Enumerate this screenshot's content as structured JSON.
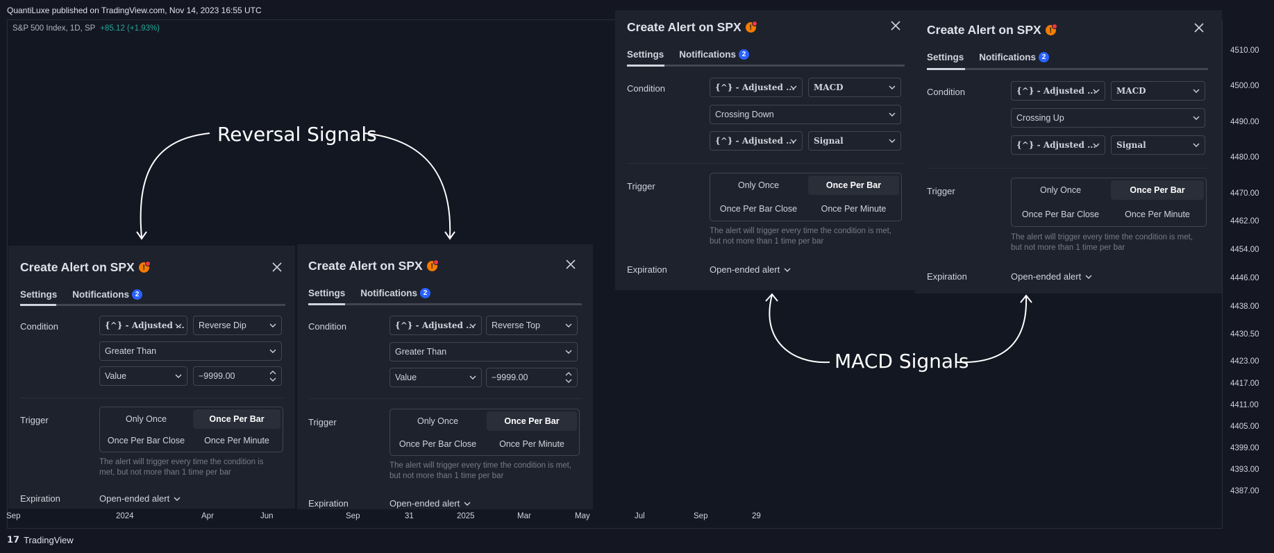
{
  "topbar": {
    "published": "QuantiLuxe published on TradingView.com, Nov 14, 2023 16:55 UTC"
  },
  "symbol": {
    "name": "S&P 500 Index, 1D, SP",
    "change": "+85.12 (+1.93%)"
  },
  "price_axis": [
    "4510.00",
    "4500.00",
    "4490.00",
    "4480.00",
    "4470.00",
    "4462.00",
    "4454.00",
    "4446.00",
    "4438.00",
    "4430.50",
    "4423.00",
    "4417.00",
    "4411.00",
    "4405.00",
    "4399.00",
    "4393.00",
    "4387.00"
  ],
  "time_axis": [
    "Sep",
    "2024",
    "Apr",
    "Jun",
    "Sep",
    "31",
    "2025",
    "Mar",
    "May",
    "Jul",
    "Sep",
    "29"
  ],
  "footer": {
    "brand": "TradingView"
  },
  "annotations": {
    "reversal": "Reversal Signals",
    "macd": "MACD Signals"
  },
  "colors": {
    "background": "#131722",
    "dialog": "#1e222d",
    "accent_badge": "#2962ff",
    "warning": "#f57c00",
    "positive": "#26a69a"
  },
  "dialogs": [
    {
      "title": "Create Alert on SPX",
      "tabs": {
        "settings": "Settings",
        "notifications": "Notifications",
        "badge": "2"
      },
      "condition_label": "Condition",
      "source": "{^} - Adjusted ...",
      "indicator": "Reverse Dip",
      "operator": "Greater Than",
      "value_type": "Value",
      "value": "−9999.00",
      "trigger_label": "Trigger",
      "trigger_options": [
        "Only Once",
        "Once Per Bar",
        "Once Per Bar Close",
        "Once Per Minute"
      ],
      "trigger_selected": "Once Per Bar",
      "hint": "The alert will trigger every time the condition is met, but not more than 1 time per bar",
      "expiration_label": "Expiration",
      "expiration_value": "Open-ended alert"
    },
    {
      "title": "Create Alert on SPX",
      "tabs": {
        "settings": "Settings",
        "notifications": "Notifications",
        "badge": "2"
      },
      "condition_label": "Condition",
      "source": "{^} - Adjusted ...",
      "indicator": "Reverse Top",
      "operator": "Greater Than",
      "value_type": "Value",
      "value": "−9999.00",
      "trigger_label": "Trigger",
      "trigger_options": [
        "Only Once",
        "Once Per Bar",
        "Once Per Bar Close",
        "Once Per Minute"
      ],
      "trigger_selected": "Once Per Bar",
      "hint": "The alert will trigger every time the condition is met, but not more than 1 time per bar",
      "expiration_label": "Expiration",
      "expiration_value": "Open-ended alert"
    },
    {
      "title": "Create Alert on SPX",
      "tabs": {
        "settings": "Settings",
        "notifications": "Notifications",
        "badge": "2"
      },
      "condition_label": "Condition",
      "source": "{^} - Adjusted ...",
      "indicator": "MACD",
      "operator": "Crossing Down",
      "source2": "{^} - Adjusted ...",
      "indicator2": "Signal",
      "trigger_label": "Trigger",
      "trigger_options": [
        "Only Once",
        "Once Per Bar",
        "Once Per Bar Close",
        "Once Per Minute"
      ],
      "trigger_selected": "Once Per Bar",
      "hint": "The alert will trigger every time the condition is met, but not more than 1 time per bar",
      "expiration_label": "Expiration",
      "expiration_value": "Open-ended alert"
    },
    {
      "title": "Create Alert on SPX",
      "tabs": {
        "settings": "Settings",
        "notifications": "Notifications",
        "badge": "2"
      },
      "condition_label": "Condition",
      "source": "{^} - Adjusted ...",
      "indicator": "MACD",
      "operator": "Crossing Up",
      "source2": "{^} - Adjusted ...",
      "indicator2": "Signal",
      "trigger_label": "Trigger",
      "trigger_options": [
        "Only Once",
        "Once Per Bar",
        "Once Per Bar Close",
        "Once Per Minute"
      ],
      "trigger_selected": "Once Per Bar",
      "hint": "The alert will trigger every time the condition is met, but not more than 1 time per bar",
      "expiration_label": "Expiration",
      "expiration_value": "Open-ended alert"
    }
  ]
}
